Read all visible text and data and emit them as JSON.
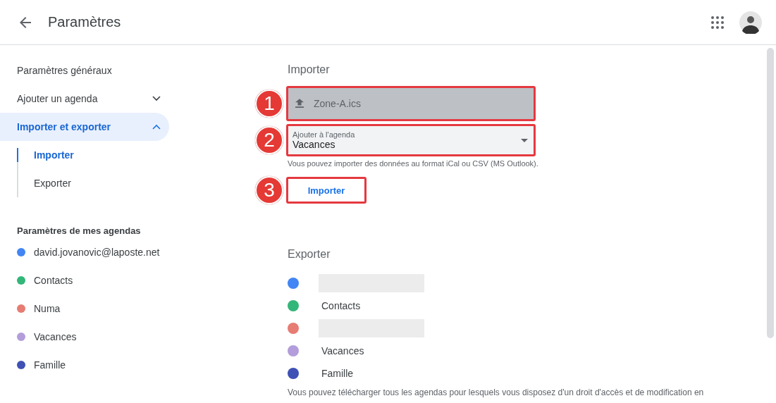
{
  "header": {
    "title": "Paramètres"
  },
  "sidebar": {
    "items": [
      {
        "kind": "link",
        "label": "Paramètres généraux",
        "selected": false
      },
      {
        "kind": "group",
        "label": "Ajouter un agenda",
        "selected": false,
        "expanded": false
      },
      {
        "kind": "group",
        "label": "Importer et exporter",
        "selected": true,
        "expanded": true,
        "children": [
          {
            "label": "Importer",
            "selected": true
          },
          {
            "label": "Exporter",
            "selected": false
          }
        ]
      }
    ],
    "section_title": "Paramètres de mes agendas",
    "calendars": [
      {
        "label": "david.jovanovic@laposte.net",
        "color": "#4285f4"
      },
      {
        "label": "Contacts",
        "color": "#33b679"
      },
      {
        "label": "Numa",
        "color": "#e67c73"
      },
      {
        "label": "Vacances",
        "color": "#b39ddb"
      },
      {
        "label": "Famille",
        "color": "#3f51b5"
      }
    ]
  },
  "import": {
    "title": "Importer",
    "file_field": {
      "value": "Zone-A.ics",
      "callout": "1"
    },
    "calendar_select": {
      "label": "Ajouter à l'agenda",
      "value": "Vacances",
      "callout": "2"
    },
    "hint": "Vous pouvez importer des données au format iCal ou CSV (MS Outlook).",
    "button": {
      "label": "Importer",
      "callout": "3"
    }
  },
  "export": {
    "title": "Exporter",
    "calendars": [
      {
        "color": "#4285f4",
        "redacted": true
      },
      {
        "label": "Contacts",
        "color": "#33b679",
        "redacted": false
      },
      {
        "color": "#e67c73",
        "redacted": true
      },
      {
        "label": "Vacances",
        "color": "#b39ddb",
        "redacted": false
      },
      {
        "label": "Famille",
        "color": "#3f51b5",
        "redacted": false
      }
    ],
    "description": "Vous pouvez télécharger tous les agendas pour lesquels vous disposez d'un droit d'accès et de modification en"
  }
}
